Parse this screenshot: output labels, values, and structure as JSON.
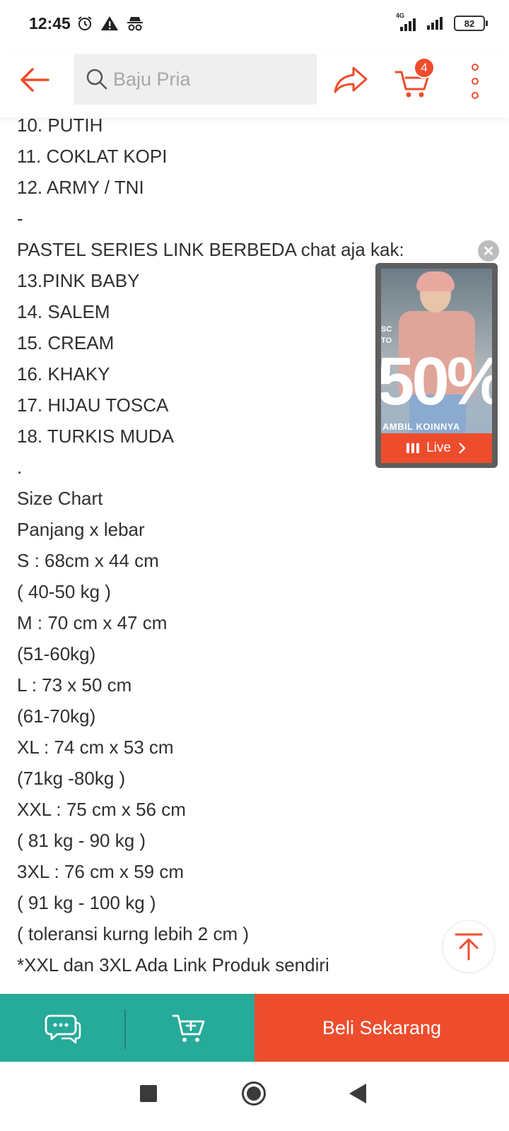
{
  "status_bar": {
    "time": "12:45",
    "network": "4G",
    "battery": "82",
    "icons": [
      "alarm-icon",
      "warning-icon",
      "incognito-icon",
      "signal-icon",
      "signal-icon",
      "battery-icon"
    ]
  },
  "top_bar": {
    "search_placeholder": "Baju Pria",
    "cart_count": "4",
    "icons": [
      "back-arrow-icon",
      "search-icon",
      "share-icon",
      "cart-icon",
      "more-vert-icon"
    ]
  },
  "description_lines": [
    "10. PUTIH",
    "11. COKLAT KOPI",
    "12. ARMY / TNI",
    "-",
    "PASTEL SERIES LINK BERBEDA chat aja kak:",
    "13.PINK BABY",
    "14. SALEM",
    "15. CREAM",
    "16. KHAKY",
    "17. HIJAU TOSCA",
    "18. TURKIS MUDA",
    ".",
    "Size Chart",
    "Panjang x lebar",
    "S : 68cm x 44 cm",
    "( 40-50 kg )",
    "M : 70 cm x 47 cm",
    "(51-60kg)",
    "L : 73 x 50 cm",
    "(61-70kg)",
    "XL : 74 cm x 53 cm",
    "(71kg -80kg )",
    "XXL : 75 cm x 56 cm",
    "( 81 kg - 90 kg )",
    "3XL : 76 cm x 59 cm",
    "( 91 kg - 100 kg )",
    "( toleransi kurng lebih 2 cm )",
    "*XXL dan 3XL Ada Link Produk sendiri"
  ],
  "live_widget": {
    "big_text": "50%",
    "small_text_1": "SC",
    "small_text_2": "TO",
    "ambil_text": "AMBIL KOINNYA",
    "live_label": "Live"
  },
  "bottom_bar": {
    "buy_label": "Beli Sekarang",
    "icons": [
      "chat-icon",
      "add-to-cart-icon"
    ]
  },
  "colors": {
    "brand": "#ee4d2d",
    "teal": "#26aa99"
  }
}
